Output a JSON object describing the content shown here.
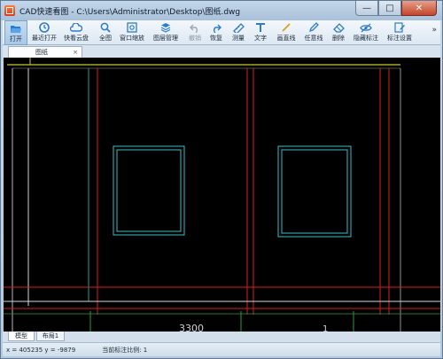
{
  "window": {
    "title": "CAD快速看图 - C:\\Users\\Administrator\\Desktop\\图纸.dwg",
    "min_symbol": "—",
    "max_symbol": "□",
    "close_symbol": "✕"
  },
  "toolbar": {
    "items": [
      {
        "label": "打开",
        "icon": "folder-open-icon",
        "enabled": true,
        "active": true
      },
      {
        "label": "最近打开",
        "icon": "clock-icon",
        "enabled": true
      },
      {
        "label": "快看云盘",
        "icon": "cloud-icon",
        "enabled": true
      },
      {
        "label": "全图",
        "icon": "full-view-icon",
        "enabled": true
      },
      {
        "label": "窗口缩放",
        "icon": "zoom-window-icon",
        "enabled": true
      },
      {
        "label": "图层管理",
        "icon": "layers-icon",
        "enabled": true
      },
      {
        "label": "撤销",
        "icon": "undo-icon",
        "enabled": false
      },
      {
        "label": "恢复",
        "icon": "redo-icon",
        "enabled": true
      },
      {
        "label": "测量",
        "icon": "measure-icon",
        "enabled": true
      },
      {
        "label": "文字",
        "icon": "text-icon",
        "enabled": true
      },
      {
        "label": "画直线",
        "icon": "line-icon",
        "enabled": true
      },
      {
        "label": "任意线",
        "icon": "pencil-icon",
        "enabled": true
      },
      {
        "label": "删除",
        "icon": "eraser-icon",
        "enabled": true
      },
      {
        "label": "隐藏标注",
        "icon": "eye-hide-icon",
        "enabled": true
      },
      {
        "label": "标注设置",
        "icon": "annotation-settings-icon",
        "enabled": true
      }
    ],
    "overflow_symbol": "»"
  },
  "document_tab": {
    "label": "图纸",
    "close_symbol": "×"
  },
  "canvas": {
    "dimension_text": "3300",
    "partial_text": "1"
  },
  "layout_tabs": [
    {
      "label": "模型",
      "active": true
    },
    {
      "label": "布局1",
      "active": false
    }
  ],
  "status": {
    "coordinates": "x = 405235  y = -9879",
    "scale": "当前标注比例: 1"
  },
  "colors": {
    "accent": "#2f7fd0",
    "canvas_bg": "#000000",
    "wall_line": "#d81e1e",
    "window_frame": "#33c1c8",
    "guide_line": "#2e9b3a",
    "yellow_line": "#c8c832"
  }
}
